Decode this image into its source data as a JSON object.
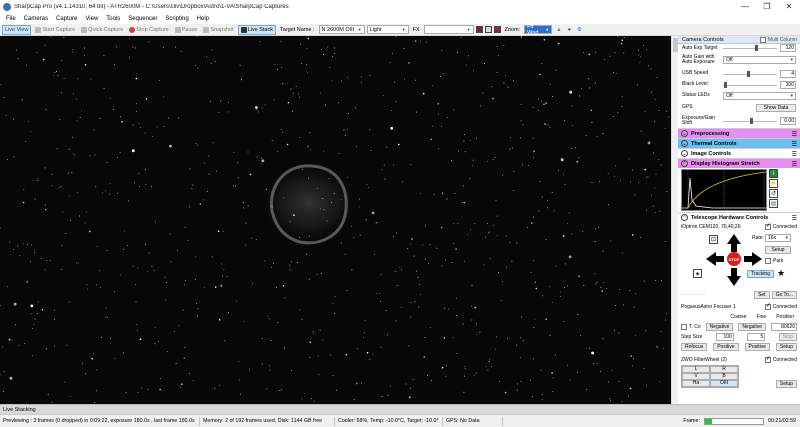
{
  "window": {
    "title": "SharpCap Pro (v4.1.14310, 64 bit) - ATR2600M - C:\\Users\\cliv\\Dropbox\\Astro\\1-VA\\SharpCap Captures",
    "controls": [
      "—",
      "❐",
      "✕"
    ]
  },
  "menu": [
    "File",
    "Cameras",
    "Capture",
    "View",
    "Tools",
    "Sequencer",
    "Scripting",
    "Help"
  ],
  "toolbar": {
    "live_view": "Live View",
    "start_capture": "Start Capture",
    "quick_capture": "Quick Capture",
    "stop_capture": "Stop Capture",
    "pause": "Pause",
    "snapshot": "Snapshot",
    "live_stack": "Live Stack",
    "target_name_label": "Target Name :",
    "target_name_value": "N 2600M OIII",
    "light_value": "Light",
    "fx_label": "FX",
    "fx_value": "",
    "zoom_label": "Zoom:",
    "zoom_value": "Fit Wnd"
  },
  "panel": {
    "header": "Camera Controls",
    "multi_column": "Multi Column",
    "rows": {
      "auto_exp_target": {
        "label": "Auto Exp Target",
        "value": "120"
      },
      "auto_gain": {
        "label": "Auto Gain with Auto Exposure",
        "value": "Off"
      },
      "usb_speed": {
        "label": "USB Speed",
        "value": "4"
      },
      "black_level": {
        "label": "Black Level",
        "value": "300"
      },
      "status_leds": {
        "label": "Status LEDs",
        "value": "Off"
      },
      "gps": {
        "label": "GPS",
        "button": "Show Data"
      },
      "exposure_gain_shift": {
        "label": "Exposure/Gain Shift",
        "value": "0.00"
      }
    },
    "sections": {
      "preprocessing": "Preprocessing",
      "thermal": "Thermal Controls",
      "image": "Image Controls",
      "histogram": "Display Histogram Stretch",
      "telescope": "Telescope Hardware Controls"
    },
    "mount": {
      "name": "iOptron CEM120, 70,40,26",
      "connected": "Connected",
      "rate_label": "Rate:",
      "rate_value": "16x",
      "setup": "Setup",
      "park": "Park",
      "stop": "STOP",
      "tracking": "Tracking",
      "set": "Set",
      "goto": "Go To..."
    },
    "focuser": {
      "name": "PegasusAstro Focuser 1",
      "connected": "Connected",
      "coarse": "Coarse",
      "fine": "Fine",
      "position_label": "Position",
      "temp_label": "T. Co",
      "negative1": "Negative",
      "negative2": "Negative",
      "position_value": "80620",
      "step_size_label": "Step Size",
      "step_size_value": "100",
      "fine_step_value": "5",
      "stop": "Stop",
      "refocus": "Refocus",
      "positive1": "Positive",
      "positive2": "Positive",
      "setup": "Setup"
    },
    "filterwheel": {
      "name": "ZWO FilterWheel (2)",
      "connected": "Connected",
      "filters": [
        "L",
        "R",
        "V",
        "B",
        "Ha",
        "OIII"
      ],
      "setup": "Setup"
    }
  },
  "status": {
    "tab": "Live Stacking",
    "previewing": "Previewing : 3 frames (0 dropped) in 0:09:22, exposure 180.0s , last frame 180.0s",
    "memory": "Memory: 2 of 192 frames used, Disk: 1144 GB free",
    "cooler": "Cooler: 68%, Temp: -10.0°C, Target: -10.0°",
    "gps": "GPS: No Data",
    "frame_label": "Frame:",
    "frame_progress": 0.12,
    "frame_time": "00:21/02:59"
  },
  "colors": {
    "preprocessing": "#e48ff0",
    "thermal": "#6fbef0",
    "histogram": "#e48ff0",
    "stop_button": "#d91f1f",
    "progress": "#2ec43a"
  }
}
